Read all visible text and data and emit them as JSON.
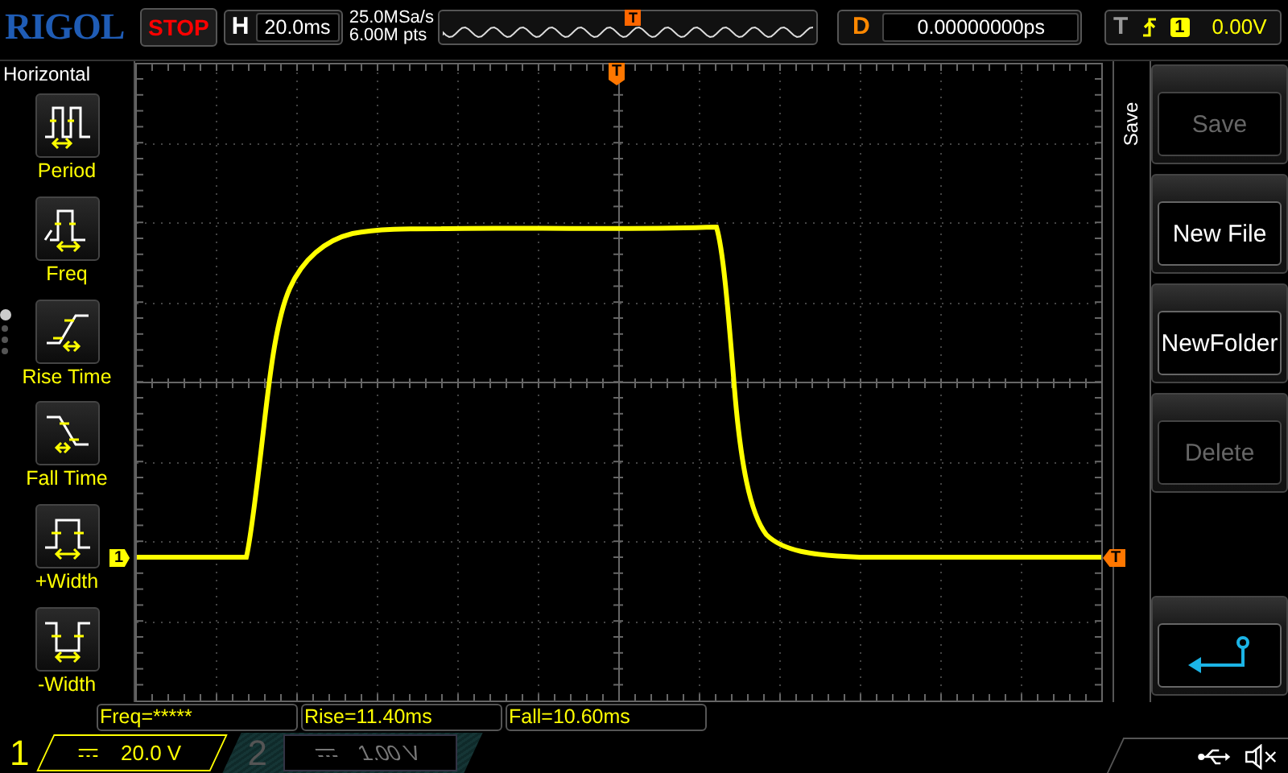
{
  "top_bar": {
    "logo": "RIGOL",
    "run_state": "STOP",
    "timebase": {
      "label": "H",
      "value": "20.0ms"
    },
    "sample_rate": "25.0MSa/s",
    "memory_depth": "6.00M pts",
    "overview_marker": "T",
    "delay": {
      "label": "D",
      "value": "0.00000000ps"
    },
    "trigger": {
      "label": "T",
      "source": "1",
      "level": "0.00V"
    }
  },
  "measure_menu": {
    "title": "Horizontal",
    "pages": [
      {
        "selected": true
      },
      {
        "selected": false
      },
      {
        "selected": false
      },
      {
        "selected": false
      }
    ],
    "items": [
      {
        "kind": "period",
        "label": "Period"
      },
      {
        "kind": "freq",
        "label": "Freq"
      },
      {
        "kind": "rise",
        "label": "Rise Time"
      },
      {
        "kind": "fall",
        "label": "Fall Time"
      },
      {
        "kind": "pwidth",
        "label": "+Width"
      },
      {
        "kind": "nwidth",
        "label": "-Width"
      }
    ]
  },
  "graticule": {
    "channel_marker": "1",
    "trigger_position_marker": "T",
    "trigger_level_marker": "T"
  },
  "softkeys": {
    "title": "Save",
    "items": [
      {
        "kind": "text",
        "label": "Save",
        "disabled": true
      },
      {
        "kind": "text",
        "label": "New File",
        "disabled": false
      },
      {
        "kind": "text",
        "label": "NewFolder",
        "disabled": false
      },
      {
        "kind": "text",
        "label": "Delete",
        "disabled": true
      },
      {
        "kind": "back"
      }
    ]
  },
  "measurements": [
    "Freq=*****",
    "Rise=11.40ms",
    "Fall=10.60ms"
  ],
  "channels": [
    {
      "number": "1",
      "scale": "20.0 V",
      "on": true
    },
    {
      "number": "2",
      "scale": "1.00 V",
      "on": false
    }
  ]
}
